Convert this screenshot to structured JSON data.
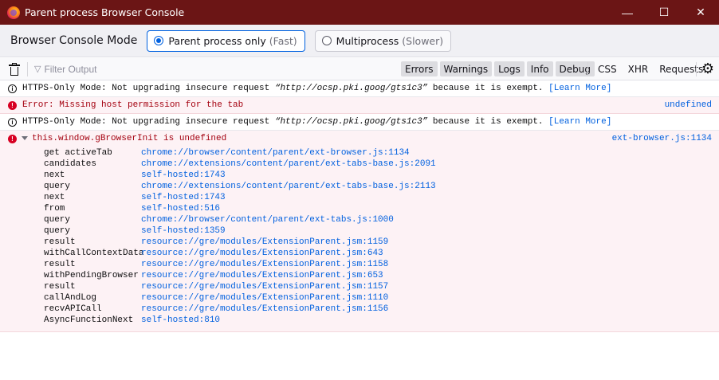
{
  "window": {
    "title": "Parent process Browser Console",
    "controls": [
      "—",
      "☐",
      "✕"
    ]
  },
  "mode": {
    "label": "Browser Console Mode",
    "options": [
      {
        "label": "Parent process only",
        "hint": "(Fast)",
        "selected": true
      },
      {
        "label": "Multiprocess",
        "hint": "(Slower)",
        "selected": false
      }
    ]
  },
  "toolbar": {
    "filter_placeholder": "Filter Output",
    "levels": [
      "Errors",
      "Warnings",
      "Logs",
      "Info",
      "Debug"
    ],
    "network": [
      "CSS",
      "XHR",
      "Requests"
    ]
  },
  "messages": [
    {
      "type": "info",
      "prefix": "HTTPS-Only Mode: Not upgrading insecure request ",
      "url": "“http://ocsp.pki.goog/gts1c3”",
      "suffix": " because it is exempt. ",
      "link": "[Learn More]"
    },
    {
      "type": "error",
      "text": "Error: Missing host permission for the tab",
      "location": "undefined"
    },
    {
      "type": "info",
      "prefix": "HTTPS-Only Mode: Not upgrading insecure request ",
      "url": "“http://ocsp.pki.goog/gts1c3”",
      "suffix": " because it is exempt. ",
      "link": "[Learn More]"
    }
  ],
  "expanded_error": {
    "text": "this.window.gBrowserInit is undefined",
    "location": "ext-browser.js:1134",
    "frames": [
      {
        "fn": "get activeTab",
        "src": "chrome://browser/content/parent/ext-browser.js:1134"
      },
      {
        "fn": "candidates",
        "src": "chrome://extensions/content/parent/ext-tabs-base.js:2091"
      },
      {
        "fn": "next",
        "src": "self-hosted:1743"
      },
      {
        "fn": "query",
        "src": "chrome://extensions/content/parent/ext-tabs-base.js:2113"
      },
      {
        "fn": "next",
        "src": "self-hosted:1743"
      },
      {
        "fn": "from",
        "src": "self-hosted:516"
      },
      {
        "fn": "query",
        "src": "chrome://browser/content/parent/ext-tabs.js:1000"
      },
      {
        "fn": "query",
        "src": "self-hosted:1359"
      },
      {
        "fn": "result",
        "src": "resource://gre/modules/ExtensionParent.jsm:1159"
      },
      {
        "fn": "withCallContextData",
        "src": "resource://gre/modules/ExtensionParent.jsm:643"
      },
      {
        "fn": "result",
        "src": "resource://gre/modules/ExtensionParent.jsm:1158"
      },
      {
        "fn": "withPendingBrowser",
        "src": "resource://gre/modules/ExtensionParent.jsm:653"
      },
      {
        "fn": "result",
        "src": "resource://gre/modules/ExtensionParent.jsm:1157"
      },
      {
        "fn": "callAndLog",
        "src": "resource://gre/modules/ExtensionParent.jsm:1110"
      },
      {
        "fn": "recvAPICall",
        "src": "resource://gre/modules/ExtensionParent.jsm:1156"
      },
      {
        "fn": "AsyncFunctionNext",
        "src": "self-hosted:810"
      }
    ]
  },
  "colors": {
    "titlebar": "#6b1515",
    "error_bg": "#fdf2f5",
    "error_text": "#a4000f",
    "link": "#0060df",
    "accent": "#0061e0"
  }
}
